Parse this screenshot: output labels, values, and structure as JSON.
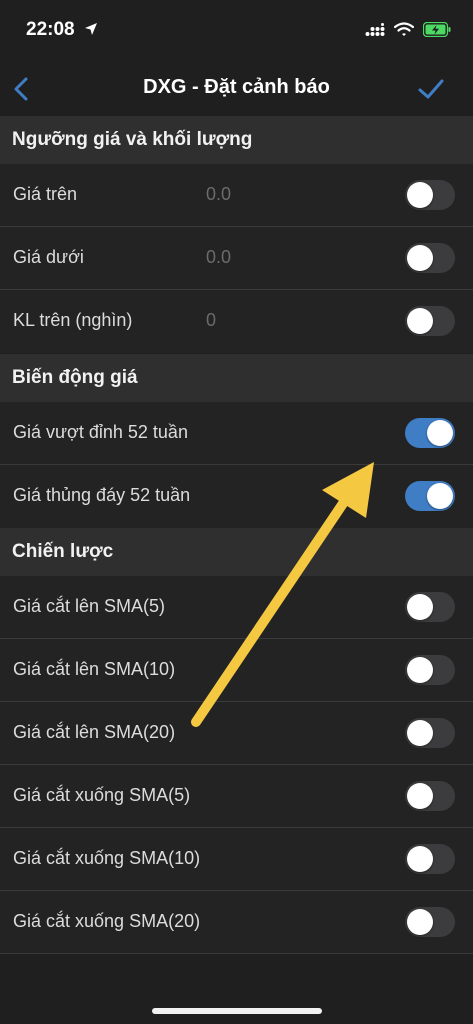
{
  "status_bar": {
    "time": "22:08"
  },
  "nav": {
    "title": "DXG - Đặt cảnh báo",
    "accent": "#3f7dc4"
  },
  "sections": [
    {
      "title": "Ngưỡng giá và khối lượng",
      "rows": [
        {
          "label": "Giá trên",
          "value": "0.0",
          "toggle_on": false
        },
        {
          "label": "Giá dưới",
          "value": "0.0",
          "toggle_on": false
        },
        {
          "label": "KL trên (nghìn)",
          "value": "0",
          "toggle_on": false
        }
      ]
    },
    {
      "title": "Biến động giá",
      "rows": [
        {
          "label": "Giá vượt đỉnh 52 tuần",
          "toggle_on": true
        },
        {
          "label": "Giá thủng đáy 52 tuần",
          "toggle_on": true
        }
      ]
    },
    {
      "title": "Chiến lược",
      "rows": [
        {
          "label": "Giá cắt lên SMA(5)",
          "toggle_on": false
        },
        {
          "label": "Giá cắt lên SMA(10)",
          "toggle_on": false
        },
        {
          "label": "Giá cắt lên SMA(20)",
          "toggle_on": false
        },
        {
          "label": "Giá cắt xuống SMA(5)",
          "toggle_on": false
        },
        {
          "label": "Giá cắt xuống SMA(10)",
          "toggle_on": false
        },
        {
          "label": "Giá cắt xuống SMA(20)",
          "toggle_on": false
        }
      ]
    }
  ],
  "annotation": {
    "arrow_color": "#f5c842"
  },
  "icons": [
    "location-arrow-icon",
    "cellular-signal-icon",
    "wifi-icon",
    "battery-charging-icon",
    "back-chevron-icon",
    "checkmark-icon"
  ]
}
